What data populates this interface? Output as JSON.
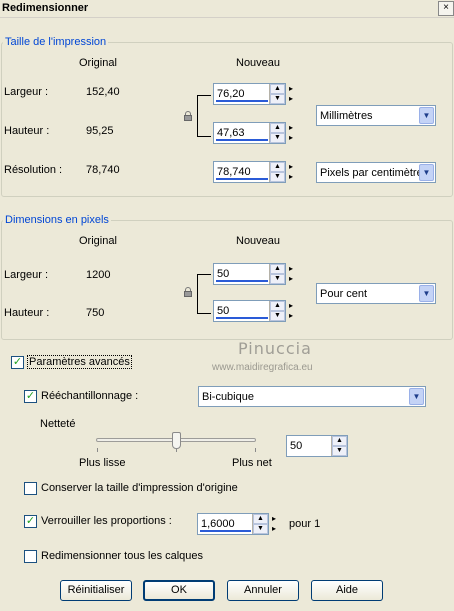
{
  "window": {
    "title": "Redimensionner",
    "close_label": "×"
  },
  "print_size": {
    "group_title": "Taille de l'impression",
    "col_original": "Original",
    "col_new": "Nouveau",
    "width_label": "Largeur :",
    "width_original": "152,40",
    "width_new": "76,20",
    "height_label": "Hauteur :",
    "height_original": "95,25",
    "height_new": "47,63",
    "units": "Millimètres",
    "resolution_label": "Résolution :",
    "resolution_original": "78,740",
    "resolution_new": "78,740",
    "resolution_units": "Pixels par centimètre"
  },
  "pixel_dimensions": {
    "group_title": "Dimensions en pixels",
    "col_original": "Original",
    "col_new": "Nouveau",
    "width_label": "Largeur :",
    "width_original": "1200",
    "width_new": "50",
    "height_label": "Hauteur :",
    "height_original": "750",
    "height_new": "50",
    "units": "Pour cent"
  },
  "advanced": {
    "label": "Paramètres avancés",
    "checked": true,
    "resampling_label": "Rééchantillonnage :",
    "resampling_checked": true,
    "resampling_method": "Bi-cubique",
    "sharpness_label": "Netteté",
    "sharpness_min_label": "Plus lisse",
    "sharpness_max_label": "Plus net",
    "sharpness_value": "50",
    "sharpness_level": 50,
    "keep_print_size_label": "Conserver la taille d'impression d'origine",
    "keep_print_size_checked": false,
    "lock_ratio_label": "Verrouiller les proportions :",
    "lock_ratio_checked": true,
    "ratio_value": "1,6000",
    "ratio_suffix": "pour 1",
    "resize_all_layers_label": "Redimensionner tous les calques",
    "resize_all_layers_checked": false
  },
  "watermark": {
    "name": "Pinuccia",
    "site": "www.maidiregrafica.eu"
  },
  "buttons": {
    "reset": "Réinitialiser",
    "ok": "OK",
    "cancel": "Annuler",
    "help": "Aide"
  },
  "icons": {
    "spin_up": "▲",
    "spin_down": "▼",
    "side_up": "▸",
    "side_down": "▸",
    "combo_arrow": "▼",
    "check": "✓"
  }
}
